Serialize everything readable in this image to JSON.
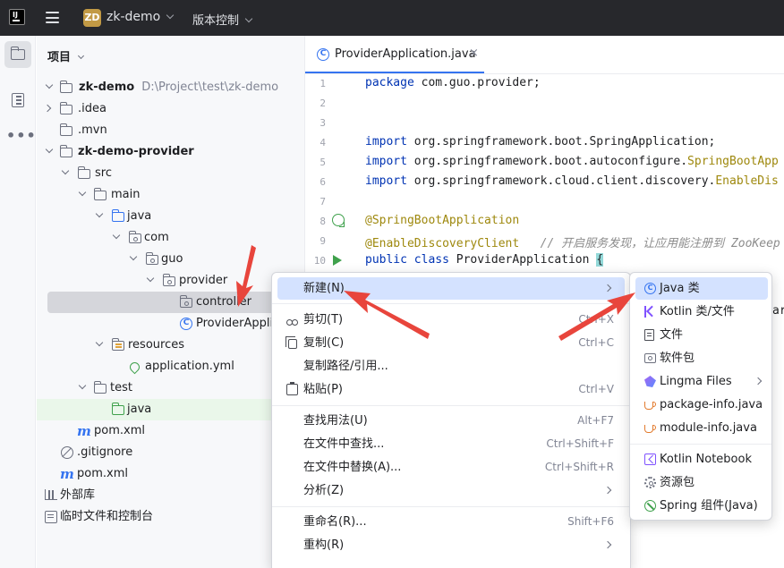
{
  "titlebar": {
    "logo_text": "IJ",
    "project_badge": "ZD",
    "project_name": "zk-demo",
    "vcs_label": "版本控制"
  },
  "project_panel": {
    "title": "项目",
    "tree": [
      {
        "label": "zk-demo",
        "path": "D:\\Project\\test\\zk-demo"
      },
      {
        "label": ".idea"
      },
      {
        "label": ".mvn"
      },
      {
        "label": "zk-demo-provider"
      },
      {
        "label": "src"
      },
      {
        "label": "main"
      },
      {
        "label": "java"
      },
      {
        "label": "com"
      },
      {
        "label": "guo"
      },
      {
        "label": "provider"
      },
      {
        "label": "controller"
      },
      {
        "label": "ProviderApplic"
      },
      {
        "label": "resources"
      },
      {
        "label": "application.yml"
      },
      {
        "label": "test"
      },
      {
        "label": "java"
      },
      {
        "label": "pom.xml"
      },
      {
        "label": ".gitignore"
      },
      {
        "label": "pom.xml"
      },
      {
        "label": "外部库"
      },
      {
        "label": "临时文件和控制台"
      }
    ],
    "pom_glyph": "m"
  },
  "editor": {
    "tab_label": "ProviderApplication.java",
    "tab_icon_glyph": "C",
    "close_glyph": "×",
    "line_numbers": [
      "1",
      "2",
      "3",
      "4",
      "5",
      "6",
      "7",
      "8",
      "9",
      "10"
    ],
    "code": {
      "l1_kw": "package",
      "l1_rest": " com.guo.provider;",
      "l4_kw": "import",
      "l4_rest": " org.springframework.boot.SpringApplication;",
      "l5_kw": "import",
      "l5_rest": " org.springframework.boot.autoconfigure.",
      "l5_ann": "SpringBootApp",
      "l6_kw": "import",
      "l6_rest": " org.springframework.cloud.client.discovery.",
      "l6_ann": "EnableDis",
      "l8_ann": "@SpringBootApplication",
      "l9_ann": "@EnableDiscoveryClient",
      "l9_cmt": "   // 开启服务发现，让应用能注册到 ZooKeep",
      "l10_kw": "public class",
      "l10_rest": " ProviderApplication ",
      "l10_brace": "{",
      "fragment_ar": "ar"
    }
  },
  "context_menu": {
    "items": [
      {
        "label": "新建(N)",
        "shortcut": ""
      },
      {
        "label": "剪切(T)",
        "shortcut": "Ctrl+X"
      },
      {
        "label": "复制(C)",
        "shortcut": "Ctrl+C"
      },
      {
        "label": "复制路径/引用...",
        "shortcut": ""
      },
      {
        "label": "粘贴(P)",
        "shortcut": "Ctrl+V"
      },
      {
        "label": "查找用法(U)",
        "shortcut": "Alt+F7"
      },
      {
        "label": "在文件中查找...",
        "shortcut": "Ctrl+Shift+F"
      },
      {
        "label": "在文件中替换(A)...",
        "shortcut": "Ctrl+Shift+R"
      },
      {
        "label": "分析(Z)",
        "shortcut": ""
      },
      {
        "label": "重命名(R)...",
        "shortcut": "Shift+F6"
      },
      {
        "label": "重构(R)",
        "shortcut": ""
      }
    ]
  },
  "submenu": {
    "items": [
      {
        "label": "Java 类",
        "icon": "java-class-icon"
      },
      {
        "label": "Kotlin 类/文件",
        "icon": "kotlin-icon"
      },
      {
        "label": "文件",
        "icon": "file-icon"
      },
      {
        "label": "软件包",
        "icon": "package-icon"
      },
      {
        "label": "Lingma Files",
        "icon": "lingma-icon"
      },
      {
        "label": "package-info.java",
        "icon": "java-cup-icon"
      },
      {
        "label": "module-info.java",
        "icon": "java-cup-icon"
      },
      {
        "label": "Kotlin Notebook",
        "icon": "kotlin-notebook-icon"
      },
      {
        "label": "资源包",
        "icon": "resource-bundle-icon"
      },
      {
        "label": "Spring 组件(Java)",
        "icon": "spring-icon"
      }
    ],
    "java_glyph": "C"
  },
  "colors": {
    "accent": "#3574f0",
    "selection": "#d4e2ff",
    "annotation_arrow": "#e8453c",
    "titlebar": "#27282c"
  }
}
